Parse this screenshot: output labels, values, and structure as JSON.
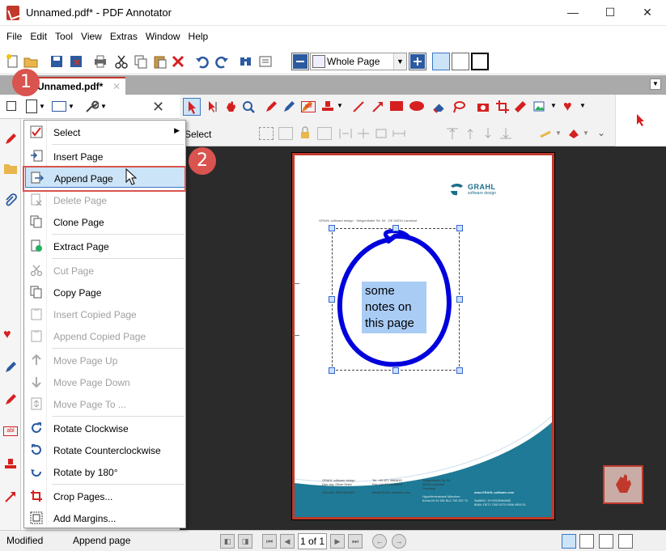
{
  "window": {
    "title": "Unnamed.pdf* - PDF Annotator",
    "minimize": "—",
    "maximize": "☐",
    "close": "✕"
  },
  "menubar": [
    "File",
    "Edit",
    "Tool",
    "View",
    "Extras",
    "Window",
    "Help"
  ],
  "toolbar": {
    "zoom_value": "Whole Page"
  },
  "tab": {
    "title": "Unnamed.pdf*",
    "close": "✕"
  },
  "anno_toolbar": {
    "select_label": "Select"
  },
  "context_menu": {
    "items": [
      {
        "label": "Select",
        "icon": "checkbox-icon",
        "enabled": true,
        "submenu": true
      },
      {
        "label": "Insert Page",
        "icon": "insert-page-icon",
        "enabled": true
      },
      {
        "label": "Append Page",
        "icon": "append-page-icon",
        "enabled": true,
        "highlighted": true
      },
      {
        "label": "Delete Page",
        "icon": "delete-page-icon",
        "enabled": false
      },
      {
        "label": "Clone Page",
        "icon": "clone-page-icon",
        "enabled": true
      },
      {
        "label": "Extract Page",
        "icon": "extract-page-icon",
        "enabled": true
      },
      {
        "label": "Cut Page",
        "icon": "scissors-icon",
        "enabled": false
      },
      {
        "label": "Copy Page",
        "icon": "copy-page-icon",
        "enabled": true
      },
      {
        "label": "Insert Copied Page",
        "icon": "insert-copied-page-icon",
        "enabled": false
      },
      {
        "label": "Append Copied Page",
        "icon": "append-copied-page-icon",
        "enabled": false
      },
      {
        "label": "Move Page Up",
        "icon": "arrow-up-icon",
        "enabled": false
      },
      {
        "label": "Move Page Down",
        "icon": "arrow-down-icon",
        "enabled": false
      },
      {
        "label": "Move Page To ...",
        "icon": "move-page-icon",
        "enabled": false
      },
      {
        "label": "Rotate Clockwise",
        "icon": "rotate-cw-icon",
        "enabled": true
      },
      {
        "label": "Rotate Counterclockwise",
        "icon": "rotate-ccw-icon",
        "enabled": true
      },
      {
        "label": "Rotate by 180°",
        "icon": "rotate-180-icon",
        "enabled": true
      },
      {
        "label": "Crop Pages...",
        "icon": "crop-icon",
        "enabled": true
      },
      {
        "label": "Add Margins...",
        "icon": "margins-icon",
        "enabled": true
      }
    ]
  },
  "callouts": [
    "1",
    "2"
  ],
  "page": {
    "logo_name": "GRAHL",
    "logo_sub": "software design",
    "address_line": "GRAHL software design · Seligenthaler Str. 54 · DE 84034 Landshut",
    "note_lines": [
      "some",
      "notes on",
      "this page"
    ],
    "footer_col1": [
      "GRAHL software design",
      "Dipl.-Ing. Oliver Grahl",
      "",
      "USt-IdNr. DE221919817"
    ],
    "footer_col2": [
      "Tel. +49 871 9663815",
      "Fax +49 871 9663816",
      "",
      "info@GRAHL-software.com"
    ],
    "footer_col3": [
      "Seligenthaler Str. 54",
      "84034 Landshut",
      "Germany",
      "",
      "HypoVereinsbank München",
      "Konto-Nr 91 951 BLZ 700 202 70"
    ],
    "footer_col4": [
      "",
      "",
      "",
      "www.GRAHL-software.com",
      "",
      "SwiftBIC: HYVEDEMM480",
      "IBAN: DE71 7002 0270 0006 4993 01"
    ]
  },
  "status": {
    "left": "Modified",
    "message": "Append page",
    "page_indicator": "1 of 1"
  },
  "colors": {
    "accent_red": "#c0392b",
    "callout_red": "#d9534f",
    "highlight_blue": "#cce4f7",
    "ink_blue": "#0000dd",
    "page_teal": "#1e7a96"
  }
}
